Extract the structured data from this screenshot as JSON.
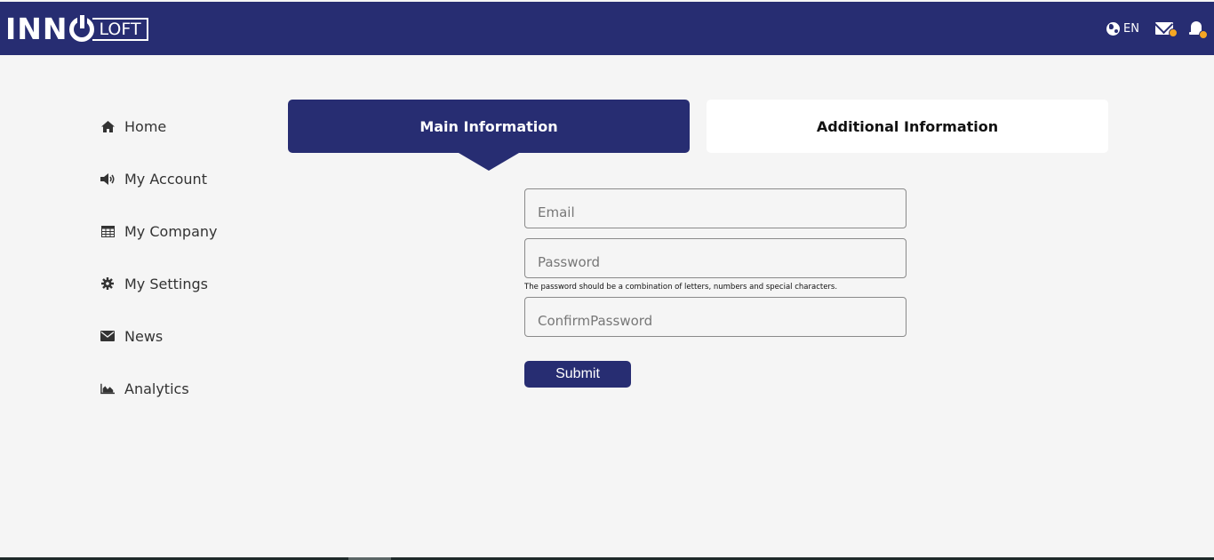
{
  "header": {
    "logo": {
      "inno": "INN",
      "loft": "LOFT"
    },
    "language": "EN",
    "accent_color": "#272d72",
    "notification_dot_color": "#f5a623"
  },
  "sidebar": {
    "items": [
      {
        "label": "Home",
        "icon": "home-icon"
      },
      {
        "label": "My Account",
        "icon": "megaphone-icon"
      },
      {
        "label": "My Company",
        "icon": "table-icon"
      },
      {
        "label": "My Settings",
        "icon": "gear-icon"
      },
      {
        "label": "News",
        "icon": "envelope-icon"
      },
      {
        "label": "Analytics",
        "icon": "area-chart-icon"
      }
    ]
  },
  "tabs": {
    "main": "Main Information",
    "additional": "Additional Information",
    "active": "main"
  },
  "form": {
    "email_placeholder": "Email",
    "password_placeholder": "Password",
    "password_hint": "The password should be a combination of letters, numbers and special characters.",
    "confirm_placeholder": "ConfirmPassword",
    "submit_label": "Submit"
  }
}
